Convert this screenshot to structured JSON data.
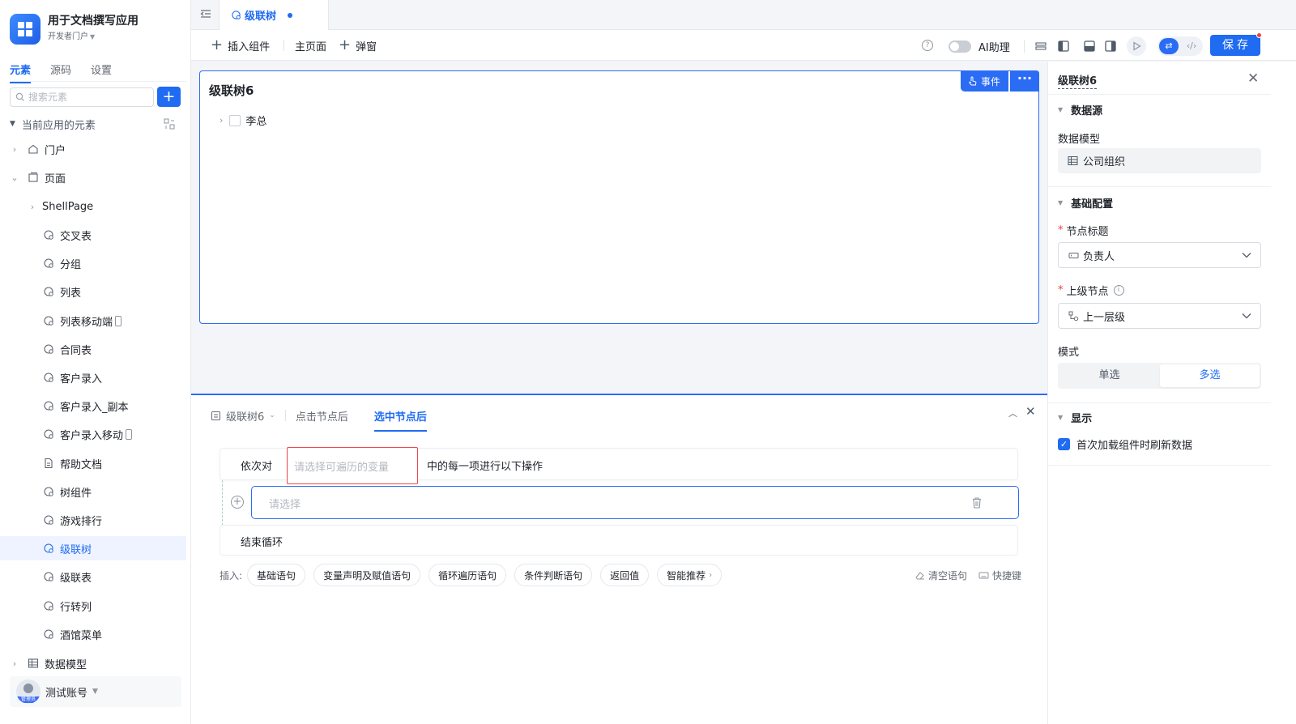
{
  "app": {
    "name": "用于文档撰写应用",
    "portal": "开发者门户"
  },
  "sidebar": {
    "tabs": [
      "元素",
      "源码",
      "设置"
    ],
    "search_placeholder": "搜索元素",
    "section_title": "当前应用的元素",
    "items": [
      {
        "label": "门户",
        "icon": "home-icon"
      },
      {
        "label": "页面",
        "icon": "page-icon"
      },
      {
        "label": "ShellPage",
        "icon": ""
      },
      {
        "label": "交叉表",
        "icon": "component-icon"
      },
      {
        "label": "分组",
        "icon": "component-icon"
      },
      {
        "label": "列表",
        "icon": "component-icon"
      },
      {
        "label": "列表移动端",
        "icon": "component-icon",
        "mobile": true
      },
      {
        "label": "合同表",
        "icon": "component-icon"
      },
      {
        "label": "客户录入",
        "icon": "component-icon"
      },
      {
        "label": "客户录入_副本",
        "icon": "component-icon"
      },
      {
        "label": "客户录入移动",
        "icon": "component-icon",
        "mobile": true
      },
      {
        "label": "帮助文档",
        "icon": "doc-icon"
      },
      {
        "label": "树组件",
        "icon": "component-icon"
      },
      {
        "label": "游戏排行",
        "icon": "component-icon"
      },
      {
        "label": "级联树",
        "icon": "component-icon",
        "selected": true
      },
      {
        "label": "级联表",
        "icon": "component-icon"
      },
      {
        "label": "行转列",
        "icon": "component-icon"
      },
      {
        "label": "酒馆菜单",
        "icon": "component-icon"
      },
      {
        "label": "数据模型",
        "icon": "table-icon"
      }
    ],
    "account": {
      "name": "测试账号",
      "role_badge": "管理员"
    }
  },
  "tabstrip": {
    "active_tab": "级联树"
  },
  "toolbar": {
    "insert_component": "插入组件",
    "main_page": "主页面",
    "popup": "弹窗",
    "ai_label": "AI助理",
    "save": "保存"
  },
  "canvas": {
    "component_title": "级联树6",
    "event_button": "事件",
    "more_button": "···",
    "tree_nodes": [
      "李总"
    ]
  },
  "events": {
    "tabs": [
      "级联树6",
      "点击节点后",
      "选中节点后"
    ],
    "active_tab": "选中节点后",
    "loop_prefix": "依次对",
    "loop_var_placeholder": "请选择可遍历的变量",
    "loop_suffix": "中的每一项进行以下操作",
    "statement_placeholder": "请选择",
    "loop_end": "结束循环",
    "insert_label": "插入:",
    "insert_chips": [
      "基础语句",
      "变量声明及赋值语句",
      "循环遍历语句",
      "条件判断语句",
      "返回值",
      "智能推荐"
    ],
    "clear_label": "清空语句",
    "shortcut_label": "快捷键"
  },
  "props": {
    "title": "级联树6",
    "datasource_group": "数据源",
    "data_model_label": "数据模型",
    "data_model_value": "公司组织",
    "basic_group": "基础配置",
    "node_title_label": "节点标题",
    "node_title_value": "负责人",
    "parent_node_label": "上级节点",
    "parent_node_value": "上一层级",
    "mode_label": "模式",
    "mode_options": [
      "单选",
      "多选"
    ],
    "mode_selected": "多选",
    "display_group": "显示",
    "refresh_on_load_label": "首次加载组件时刷新数据",
    "refresh_on_load": true
  },
  "colors": {
    "accent": "#1f6bf2",
    "error": "#f53f3f"
  }
}
